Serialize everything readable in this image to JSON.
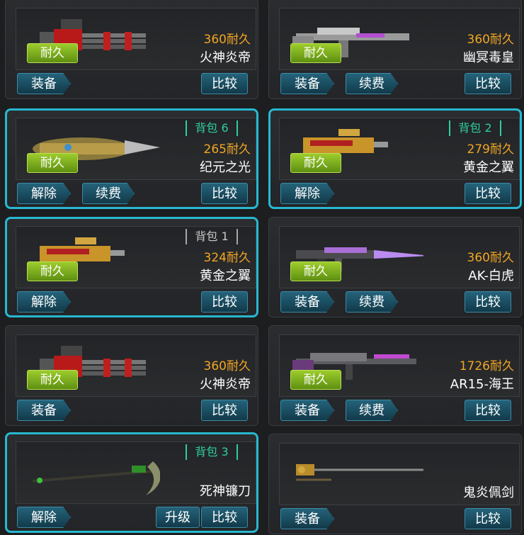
{
  "cards": [
    {
      "durability": "360耐久",
      "name": "火神炎帝",
      "badge": "耐久",
      "buttons": [
        "装备"
      ],
      "compare": "比较",
      "bag": "",
      "weapon": "minigun-red"
    },
    {
      "durability": "360耐久",
      "name": "幽冥毒皇",
      "badge": "耐久",
      "buttons": [
        "装备",
        "续费"
      ],
      "compare": "比较",
      "bag": "",
      "weapon": "sniper-silver"
    },
    {
      "durability": "265耐久",
      "name": "纪元之光",
      "badge": "耐久",
      "buttons": [
        "解除",
        "续费"
      ],
      "compare": "比较",
      "bag": "背包 6",
      "weapon": "cannon-gold"
    },
    {
      "durability": "279耐久",
      "name": "黄金之翼",
      "badge": "耐久",
      "buttons": [
        "解除"
      ],
      "compare": "比较",
      "bag": "背包 2",
      "weapon": "smg-gold"
    },
    {
      "durability": "324耐久",
      "name": "黄金之翼",
      "badge": "耐久",
      "buttons": [
        "解除"
      ],
      "compare": "比较",
      "bag": "背包 1",
      "weapon": "smg-gold"
    },
    {
      "durability": "360耐久",
      "name": "AK-白虎",
      "badge": "耐久",
      "buttons": [
        "装备",
        "续费"
      ],
      "compare": "比较",
      "bag": "",
      "weapon": "ak-purple"
    },
    {
      "durability": "360耐久",
      "name": "火神炎帝",
      "badge": "耐久",
      "buttons": [
        "装备"
      ],
      "compare": "比较",
      "bag": "",
      "weapon": "minigun-red"
    },
    {
      "durability": "1726耐久",
      "name": "AR15-海王",
      "badge": "耐久",
      "buttons": [
        "装备",
        "续费"
      ],
      "compare": "比较",
      "bag": "",
      "weapon": "ar15-purple"
    },
    {
      "durability": "",
      "name": "死神镰刀",
      "badge": "",
      "buttons": [
        "解除"
      ],
      "compare": "比较",
      "upgrade": "升级",
      "bag": "背包 3",
      "weapon": "scythe-green"
    },
    {
      "durability": "",
      "name": "鬼炎佩剑",
      "badge": "",
      "buttons": [
        "装备"
      ],
      "compare": "比较",
      "bag": "",
      "weapon": "rapier-gold"
    }
  ],
  "colors": {
    "selected_border": "#28b8d0",
    "durability_text": "#f2a623",
    "badge_green": "#7fb51f",
    "button_blue": "#1c5066",
    "bag_teal": "#2fcf9c"
  }
}
